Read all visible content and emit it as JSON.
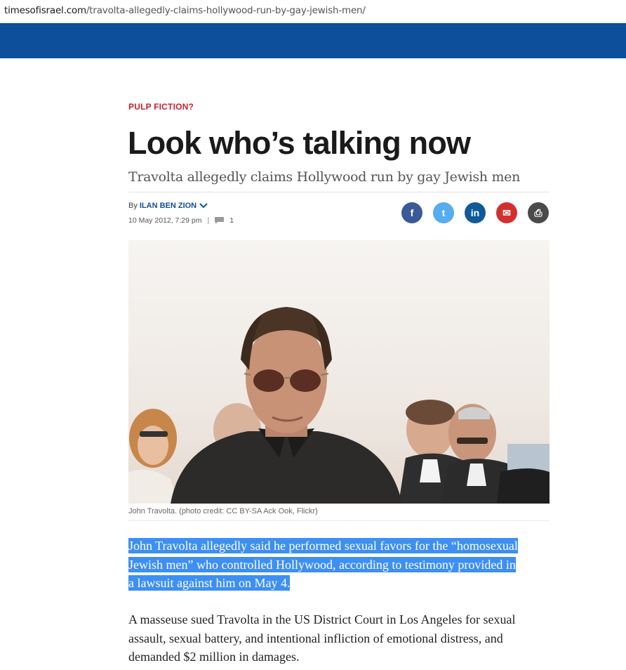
{
  "browser": {
    "url_host": "timesofisrael.com",
    "url_path": "/travolta-allegedly-claims-hollywood-run-by-gay-jewish-men/"
  },
  "article": {
    "kicker": "PULP FICTION?",
    "headline": "Look who’s talking now",
    "subhead": "Travolta allegedly claims Hollywood run by gay Jewish men",
    "by_prefix": "By",
    "author": "ILAN BEN ZION",
    "date": "10 May 2012, 7:29 pm",
    "separator": "|",
    "comment_count": "1",
    "caption": "John Travolta. (photo credit: CC BY-SA Ack Ook, Flickr)",
    "lead": "John Travolta allegedly said he performed sexual favors for the “homosexual Jewish men” who controlled Hollywood, according to testimony provided in a lawsuit against him on May 4.",
    "paragraph": "A masseuse sued Travolta in the US District Court in Los Angeles for sexual assault, sexual battery, and intentional infliction of emotional distress, and demanded $2 million in damages."
  },
  "share": [
    {
      "name": "facebook-icon",
      "glyph": "f",
      "color": "#3b5998"
    },
    {
      "name": "twitter-icon",
      "glyph": "t",
      "color": "#55acee"
    },
    {
      "name": "linkedin-icon",
      "glyph": "in",
      "color": "#0e5a9a"
    },
    {
      "name": "email-icon",
      "glyph": "✉",
      "color": "#d32f2f"
    },
    {
      "name": "print-icon",
      "glyph": "⎙",
      "color": "#4a4a4a"
    }
  ],
  "colors": {
    "brand": "#0e4f9c",
    "kicker": "#c4202f",
    "selection": "#3d8ff3"
  }
}
